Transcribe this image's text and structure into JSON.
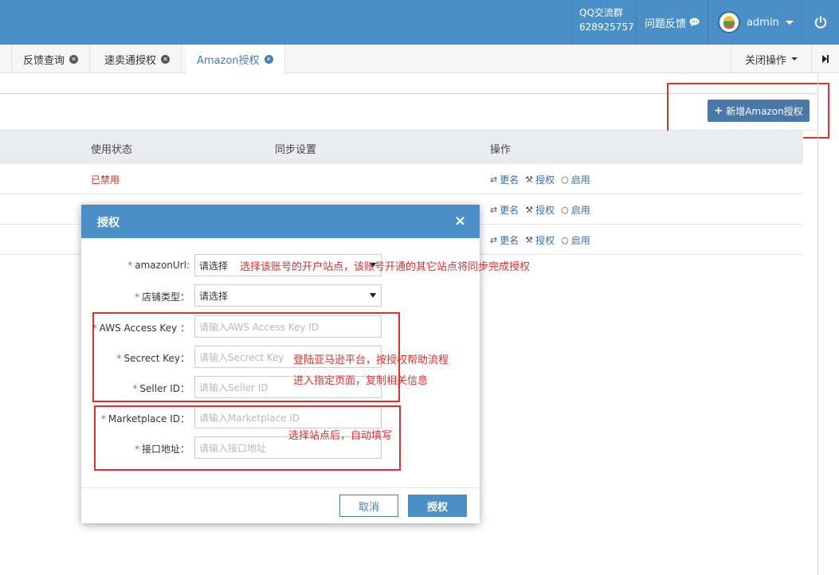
{
  "topbar": {
    "qq_label": "QQ交流群",
    "qq_number": "628925757",
    "feedback_label": "问题反馈",
    "username": "admin"
  },
  "tabs": [
    {
      "label": "反馈查询"
    },
    {
      "label": "速卖通授权"
    },
    {
      "label": "Amazon授权",
      "active": true
    }
  ],
  "tabbar": {
    "close_ops_label": "关闭操作"
  },
  "panel": {
    "add_button_label": "新增Amazon授权",
    "columns": [
      "使用状态",
      "同步设置",
      "操作"
    ],
    "rows": [
      {
        "status": "已禁用",
        "ops": [
          "更名",
          "授权",
          "启用"
        ]
      },
      {
        "status": "",
        "ops": [
          "更名",
          "授权",
          "启用"
        ]
      },
      {
        "status": "",
        "ops": [
          "更名",
          "授权",
          "启用"
        ]
      }
    ]
  },
  "modal": {
    "title": "授权",
    "fields": [
      {
        "label": "amazonUrl:",
        "value": "请选择",
        "type": "select"
      },
      {
        "label": "店铺类型：",
        "value": "请选择",
        "type": "select"
      },
      {
        "label": "AWS Access Key ：",
        "placeholder": "请输入AWS Access Key ID"
      },
      {
        "label": "Secrect Key：",
        "placeholder": "请输入Secrect Key"
      },
      {
        "label": "Seller ID：",
        "placeholder": "请输入Seller ID"
      },
      {
        "label": "Marketplace ID：",
        "placeholder": "请输入Marketplace ID"
      },
      {
        "label": "接口地址：",
        "placeholder": "请输入接口地址"
      }
    ],
    "cancel_label": "取消",
    "ok_label": "授权"
  },
  "annotations": {
    "site_note": "选择该账号的开户站点，该账号开通的其它站点将同步完成授权",
    "login_note_1": "登陆亚马逊平台，按授权帮助流程",
    "login_note_2": "进入指定页面，复制相关信息",
    "auto_fill_note": "选择站点后，自动填写"
  },
  "colors": {
    "brand": "#4a8fc8",
    "button": "#4a78a8",
    "annotation_red": "#e0312c",
    "disabled_status": "#c9302c"
  }
}
